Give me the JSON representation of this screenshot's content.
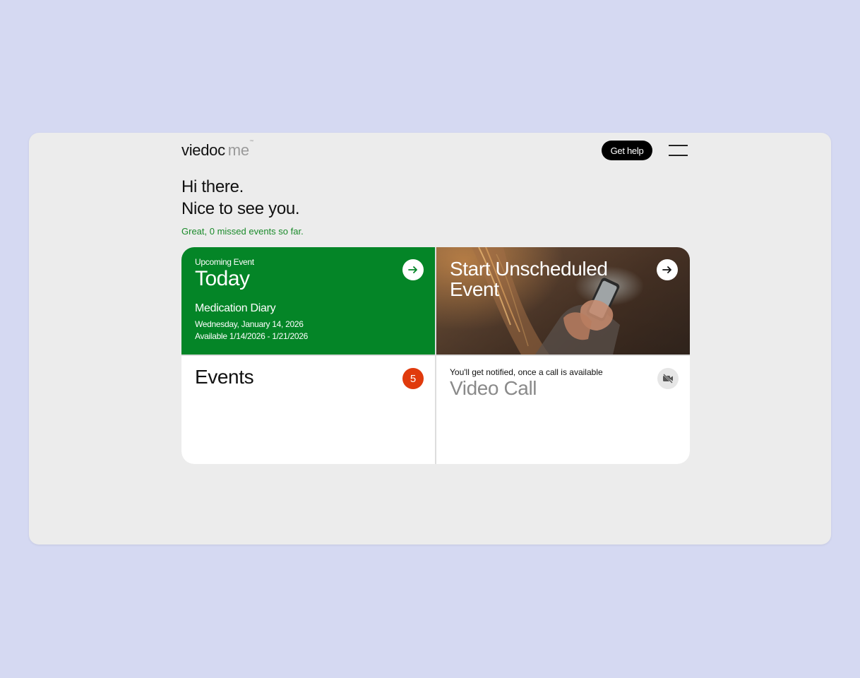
{
  "header": {
    "logo_main": "viedoc",
    "logo_sub": "me",
    "logo_tm": "™",
    "help_label": "Get help"
  },
  "greeting": {
    "line1": "Hi there.",
    "line2": "Nice to see you.",
    "status": "Great, 0 missed events so far."
  },
  "upcoming": {
    "label": "Upcoming Event",
    "when": "Today",
    "title": "Medication Diary",
    "date": "Wednesday, January 14, 2026",
    "available": "Available 1/14/2026 - 1/21/2026"
  },
  "unscheduled": {
    "title": "Start Unscheduled Event"
  },
  "events": {
    "title": "Events",
    "count": "5"
  },
  "video": {
    "note": "You'll get notified, once a call is available",
    "title": "Video Call"
  },
  "colors": {
    "background": "#d5d9f2",
    "panel": "#ececec",
    "green": "#048527",
    "status_green": "#1a8a2a",
    "badge_red": "#e03a0c",
    "muted_text": "#8a8a8a"
  }
}
